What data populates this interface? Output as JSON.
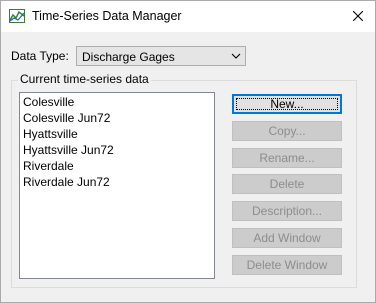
{
  "window": {
    "title": "Time-Series Data Manager",
    "app_icon": "chart-icon",
    "close_icon": "close-icon"
  },
  "data_type": {
    "label": "Data Type:",
    "selected": "Discharge Gages"
  },
  "group": {
    "title": "Current time-series data",
    "items": [
      "Colesville",
      "Colesville Jun72",
      "Hyattsville",
      "Hyattsville Jun72",
      "Riverdale",
      "Riverdale Jun72"
    ]
  },
  "buttons": [
    {
      "label": "New...",
      "enabled": true,
      "default": true
    },
    {
      "label": "Copy...",
      "enabled": false
    },
    {
      "label": "Rename...",
      "enabled": false
    },
    {
      "label": "Delete",
      "enabled": false
    },
    {
      "label": "Description...",
      "enabled": false
    },
    {
      "label": "Add Window",
      "enabled": false
    },
    {
      "label": "Delete Window",
      "enabled": false
    }
  ],
  "colors": {
    "accent": "#0078d7",
    "disabled_text": "#8d8d8d"
  }
}
